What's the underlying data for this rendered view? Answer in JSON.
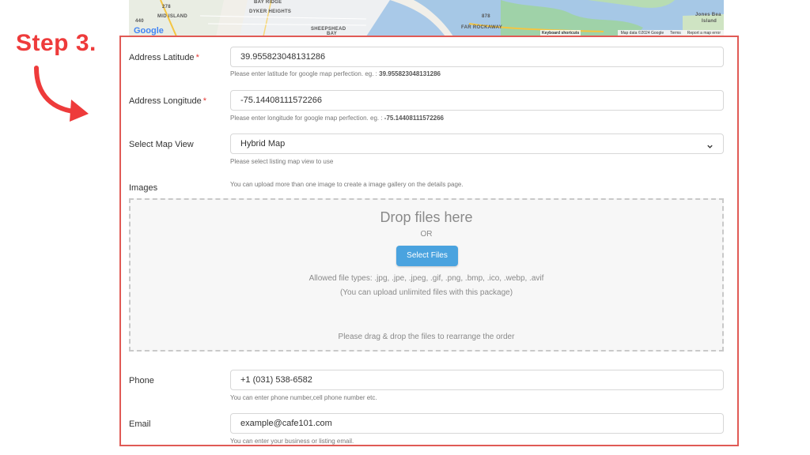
{
  "map": {
    "labels": {
      "bay_ridge": "BAY RIDGE",
      "dyker": "DYKER HEIGHTS",
      "mid_island": "MID ISLAND",
      "sheepshead": "SHEEPSHEAD",
      "bay": "BAY",
      "far_rockaway": "FAR ROCKAWAY",
      "jones_beach": "Jones Bea",
      "island": "Island",
      "route_878": "878",
      "route_278": "278",
      "route_440": "440"
    },
    "google": "Google",
    "keyboard_shortcuts": "Keyboard shortcuts",
    "map_data": "Map data ©2024 Google",
    "terms": "Terms",
    "report": "Report a map error"
  },
  "annotation": {
    "step": "Step 3."
  },
  "form": {
    "latitude": {
      "label": "Address Latitude",
      "required": "*",
      "value": "39.955823048131286",
      "help_prefix": "Please enter latitude for google map perfection. eg. : ",
      "help_example": "39.955823048131286"
    },
    "longitude": {
      "label": "Address Longitude",
      "required": "*",
      "value": "-75.14408111572266",
      "help_prefix": "Please enter longitude for google map perfection. eg. : ",
      "help_example": "-75.14408111572266"
    },
    "map_view": {
      "label": "Select Map View",
      "value": "Hybrid Map",
      "help": "Please select listing map view to use"
    },
    "images": {
      "label": "Images",
      "help": "You can upload more than one image to create a image gallery on the details page.",
      "drop_title": "Drop files here",
      "or": "OR",
      "select_button": "Select Files",
      "allowed": "Allowed file types: .jpg, .jpe, .jpeg, .gif, .png, .bmp, .ico, .webp, .avif",
      "unlimited": "(You can upload unlimited files with this package)",
      "drag_hint": "Please drag & drop the files to rearrange the order"
    },
    "phone": {
      "label": "Phone",
      "value": "+1 (031) 538-6582",
      "help": "You can enter phone number,cell phone number etc."
    },
    "email": {
      "label": "Email",
      "value": "example@cafe101.com",
      "help": "You can enter your business or listing email."
    }
  },
  "colors": {
    "accent_red": "#ee3b3b",
    "button_blue": "#4aa3df",
    "panel_border": "#e05a55"
  }
}
